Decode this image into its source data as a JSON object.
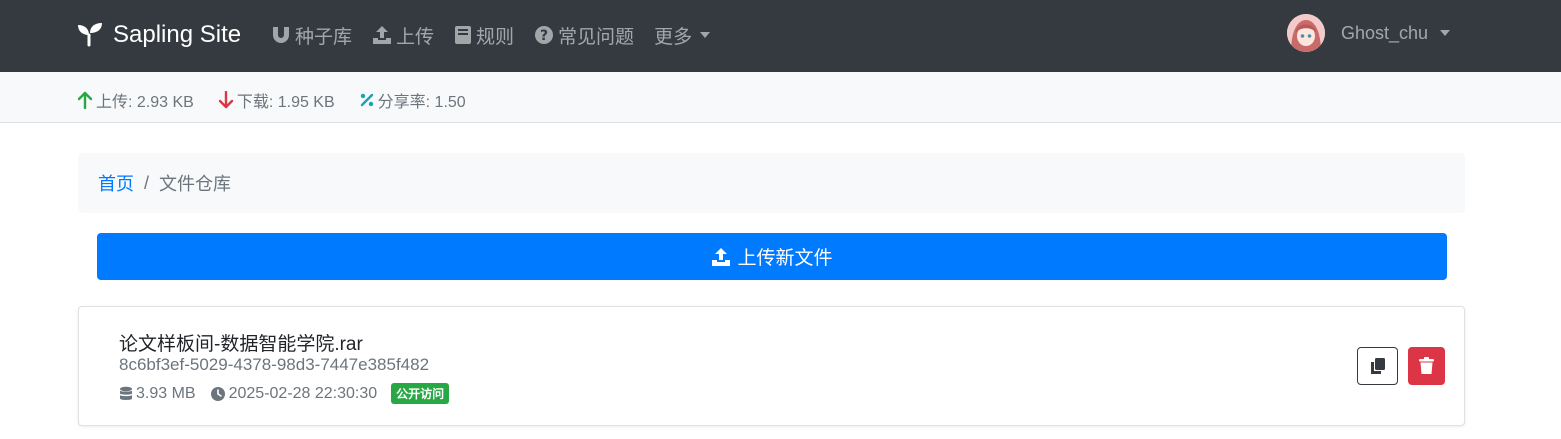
{
  "navbar": {
    "brand": "Sapling Site",
    "items": [
      {
        "label": "种子库",
        "icon": "magnet-icon"
      },
      {
        "label": "上传",
        "icon": "upload-icon"
      },
      {
        "label": "规则",
        "icon": "book-icon"
      },
      {
        "label": "常见问题",
        "icon": "question-circle-icon"
      },
      {
        "label": "更多",
        "icon": "chevron-down-icon"
      }
    ],
    "user": {
      "name": "Ghost_chu",
      "icon": "avatar"
    }
  },
  "stats": {
    "upload": "上传: 2.93 KB",
    "download": "下载: 1.95 KB",
    "ratio": "分享率: 1.50"
  },
  "breadcrumb": {
    "home": "首页",
    "separator": "/",
    "current": "文件仓库"
  },
  "upload_button": {
    "label": "上传新文件"
  },
  "files": [
    {
      "name": "论文样板间-数据智能学院.rar",
      "id": "8c6bf3ef-5029-4378-98d3-7447e385f482",
      "size": "3.93 MB",
      "date": "2025-02-28 22:30:30",
      "badge": "公开访问"
    }
  ],
  "colors": {
    "navbar": "#343a40",
    "primary": "#007bff",
    "success": "#28a745",
    "danger": "#dc3545",
    "info": "#17a2b8"
  }
}
